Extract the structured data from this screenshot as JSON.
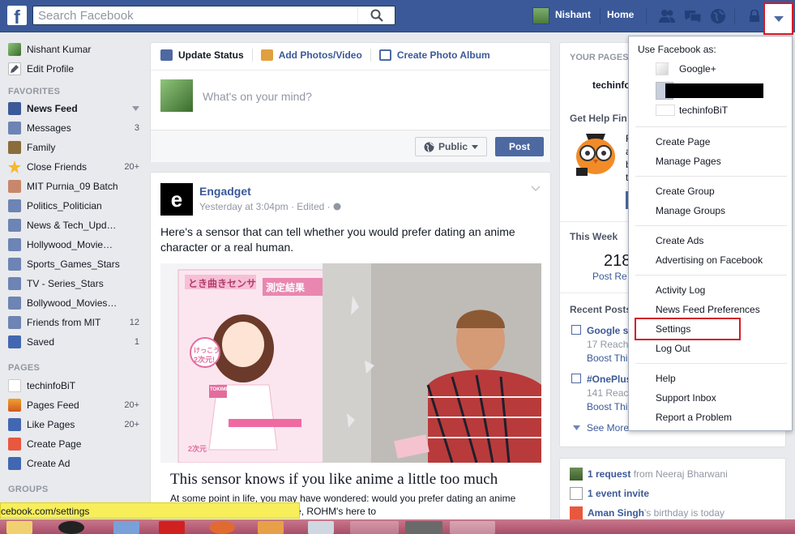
{
  "topbar": {
    "search_placeholder": "Search Facebook",
    "user_name": "Nishant",
    "home_label": "Home"
  },
  "left_nav": {
    "profile_name": "Nishant Kumar",
    "edit_profile": "Edit Profile",
    "favorites_heading": "FAVORITES",
    "favorites": [
      {
        "label": "News Feed",
        "count": ""
      },
      {
        "label": "Messages",
        "count": "3"
      },
      {
        "label": "Family",
        "count": ""
      },
      {
        "label": "Close Friends",
        "count": "20+"
      },
      {
        "label": "MIT Purnia_09 Batch",
        "count": ""
      },
      {
        "label": "Politics_Politician",
        "count": ""
      },
      {
        "label": "News & Tech_Upd…",
        "count": ""
      },
      {
        "label": "Hollywood_Movie…",
        "count": ""
      },
      {
        "label": "Sports_Games_Stars",
        "count": ""
      },
      {
        "label": "TV - Series_Stars",
        "count": ""
      },
      {
        "label": "Bollywood_Movies…",
        "count": ""
      },
      {
        "label": "Friends from MIT",
        "count": "12"
      },
      {
        "label": "Saved",
        "count": "1"
      }
    ],
    "pages_heading": "PAGES",
    "pages": [
      {
        "label": "techinfoBiT",
        "count": ""
      },
      {
        "label": "Pages Feed",
        "count": "20+"
      },
      {
        "label": "Like Pages",
        "count": "20+"
      },
      {
        "label": "Create Page",
        "count": ""
      },
      {
        "label": "Create Ad",
        "count": ""
      }
    ],
    "groups_heading": "GROUPS"
  },
  "composer": {
    "tab_update": "Update Status",
    "tab_photos": "Add Photos/Video",
    "tab_album": "Create Photo Album",
    "placeholder": "What's on your mind?",
    "privacy": "Public",
    "post_button": "Post"
  },
  "post": {
    "logo_letter": "e",
    "author": "Engadget",
    "meta": "Yesterday at 3:04pm · Edited ·",
    "text": "Here's a sensor that can tell whether you would prefer dating an anime character or a real human.",
    "image_text_1": "とき曲きセンサ",
    "image_text_2": "測定結果",
    "image_text_3": "けっこう",
    "image_text_4": "2次元!",
    "image_text_5": "TOKIMEKI",
    "image_text_6": "2次元",
    "link_title": "This sensor knows if you like anime a little too much",
    "link_desc": "At some point in life, you may have wondered: would you prefer dating an anime human being? If you're unsure, ROHM's here to"
  },
  "right_column": {
    "your_pages": "YOUR PAGES",
    "page_name": "techinfo",
    "get_help": "Get Help Fin",
    "help_char_1": "F",
    "help_char_2": "a",
    "help_char_3": "b",
    "help_char_4": "t",
    "this_week": "This Week",
    "week_number": "218",
    "post_reach": "Post Re",
    "recent_posts": "Recent Posts",
    "posts": [
      {
        "title": "Google s",
        "reach": "17 Reach",
        "boost": "Boost Thi"
      },
      {
        "title": "#OnePlus",
        "reach": "141 Reach",
        "boost": "Boost Thi"
      }
    ],
    "see_more": "See More",
    "requests": [
      {
        "strong": "1 request",
        "rest": " from Neeraj Bharwani"
      },
      {
        "strong": "1 event invite",
        "rest": ""
      },
      {
        "strong": "Aman Singh",
        "rest": "'s birthday is today"
      }
    ]
  },
  "dropdown": {
    "caption": "Use Facebook as:",
    "accounts": [
      "Google+",
      "techinfoBiT"
    ],
    "items_a": [
      "Create Page",
      "Manage Pages"
    ],
    "items_b": [
      "Create Group",
      "Manage Groups"
    ],
    "items_c": [
      "Create Ads",
      "Advertising on Facebook"
    ],
    "items_d": [
      "Activity Log",
      "News Feed Preferences",
      "Settings",
      "Log Out"
    ],
    "items_e": [
      "Help",
      "Support Inbox",
      "Report a Problem"
    ]
  },
  "status_url": "cebook.com/settings",
  "colors": {
    "brand_blue": "#3b5998",
    "highlight_red": "#d11d2a",
    "statusbar_yellow": "#f7ee5a"
  }
}
